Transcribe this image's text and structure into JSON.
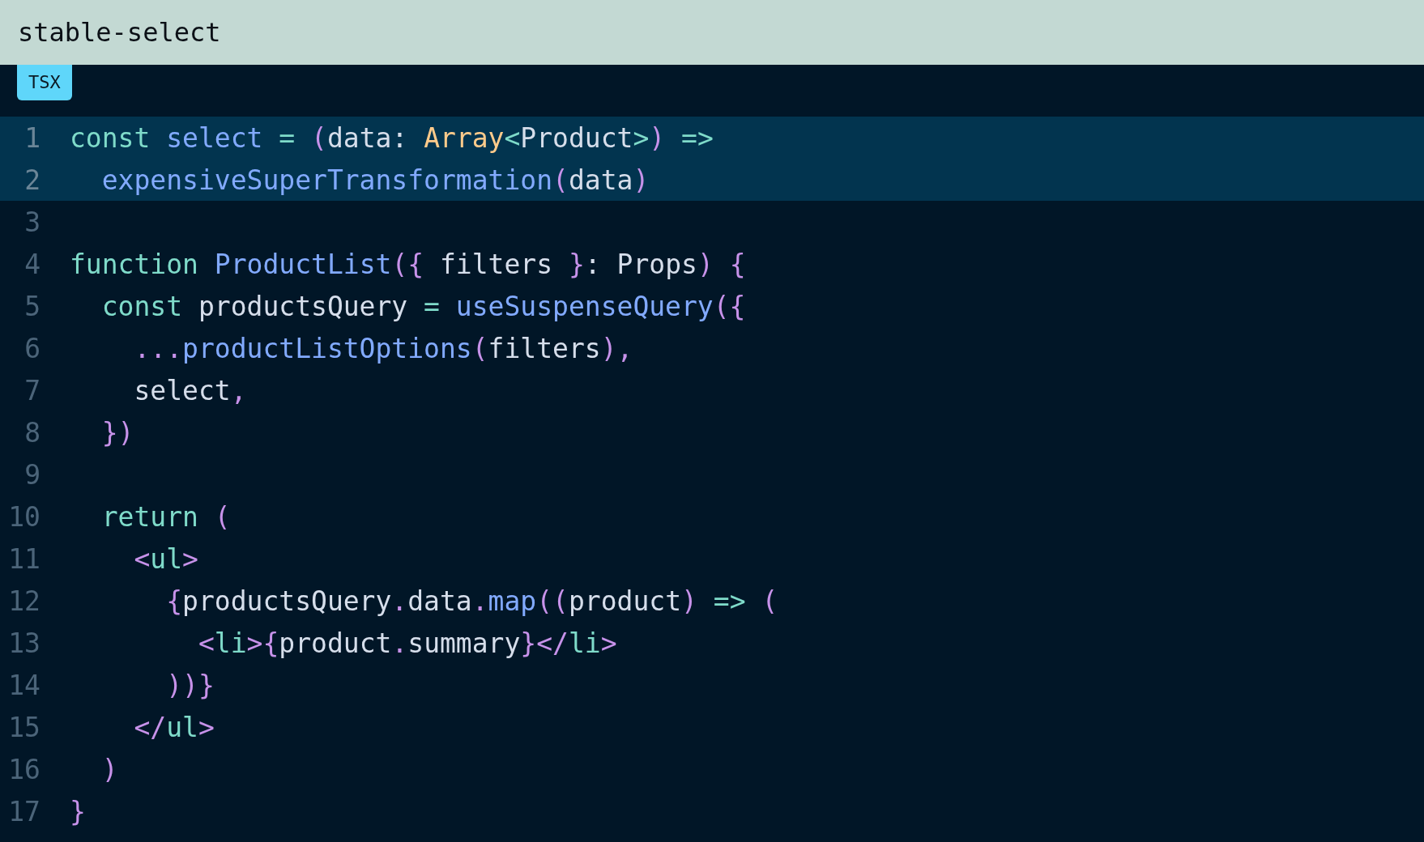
{
  "title": "stable-select",
  "language_badge": "TSX",
  "lines": [
    {
      "number": "1",
      "highlighted": true,
      "tokens": [
        {
          "text": "const",
          "kind": "keyword"
        },
        {
          "text": " select",
          "kind": "function"
        },
        {
          "text": " =",
          "kind": "keyword"
        },
        {
          "text": " (",
          "kind": "punctuation"
        },
        {
          "text": "data: ",
          "kind": "plain"
        },
        {
          "text": "Array",
          "kind": "type"
        },
        {
          "text": "<",
          "kind": "keyword"
        },
        {
          "text": "Product",
          "kind": "plain"
        },
        {
          "text": ">",
          "kind": "keyword"
        },
        {
          "text": ")",
          "kind": "punctuation"
        },
        {
          "text": " =>",
          "kind": "keyword"
        }
      ]
    },
    {
      "number": "2",
      "highlighted": true,
      "tokens": [
        {
          "text": "  expensiveSuperTransformation",
          "kind": "function"
        },
        {
          "text": "(",
          "kind": "punctuation"
        },
        {
          "text": "data",
          "kind": "plain"
        },
        {
          "text": ")",
          "kind": "punctuation"
        }
      ]
    },
    {
      "number": "3",
      "highlighted": false
    },
    {
      "number": "4",
      "highlighted": false,
      "tokens": [
        {
          "text": "function",
          "kind": "keyword"
        },
        {
          "text": " ProductList",
          "kind": "function"
        },
        {
          "text": "({",
          "kind": "punctuation"
        },
        {
          "text": " filters ",
          "kind": "plain"
        },
        {
          "text": "}",
          "kind": "punctuation"
        },
        {
          "text": ": Props",
          "kind": "plain"
        },
        {
          "text": ")",
          "kind": "punctuation"
        },
        {
          "text": " {",
          "kind": "punctuation"
        }
      ]
    },
    {
      "number": "5",
      "highlighted": false,
      "tokens": [
        {
          "text": "  const",
          "kind": "keyword"
        },
        {
          "text": " productsQuery ",
          "kind": "plain"
        },
        {
          "text": "=",
          "kind": "keyword"
        },
        {
          "text": " useSuspenseQuery",
          "kind": "function"
        },
        {
          "text": "({",
          "kind": "punctuation"
        }
      ]
    },
    {
      "number": "6",
      "highlighted": false,
      "tokens": [
        {
          "text": "    ...",
          "kind": "punctuation"
        },
        {
          "text": "productListOptions",
          "kind": "function"
        },
        {
          "text": "(",
          "kind": "punctuation"
        },
        {
          "text": "filters",
          "kind": "plain"
        },
        {
          "text": "),",
          "kind": "punctuation"
        }
      ]
    },
    {
      "number": "7",
      "highlighted": false,
      "tokens": [
        {
          "text": "    select",
          "kind": "plain"
        },
        {
          "text": ",",
          "kind": "punctuation"
        }
      ]
    },
    {
      "number": "8",
      "highlighted": false,
      "tokens": [
        {
          "text": "  })",
          "kind": "punctuation"
        }
      ]
    },
    {
      "number": "9",
      "highlighted": false
    },
    {
      "number": "10",
      "highlighted": false,
      "tokens": [
        {
          "text": "  return",
          "kind": "keyword"
        },
        {
          "text": " (",
          "kind": "punctuation"
        }
      ]
    },
    {
      "number": "11",
      "highlighted": false,
      "tokens": [
        {
          "text": "    <",
          "kind": "punctuation"
        },
        {
          "text": "ul",
          "kind": "keyword"
        },
        {
          "text": ">",
          "kind": "punctuation"
        }
      ]
    },
    {
      "number": "12",
      "highlighted": false,
      "tokens": [
        {
          "text": "      {",
          "kind": "punctuation"
        },
        {
          "text": "productsQuery",
          "kind": "plain"
        },
        {
          "text": ".",
          "kind": "punctuation"
        },
        {
          "text": "data",
          "kind": "plain"
        },
        {
          "text": ".",
          "kind": "punctuation"
        },
        {
          "text": "map",
          "kind": "function"
        },
        {
          "text": "((",
          "kind": "punctuation"
        },
        {
          "text": "product",
          "kind": "plain"
        },
        {
          "text": ")",
          "kind": "punctuation"
        },
        {
          "text": " =>",
          "kind": "keyword"
        },
        {
          "text": " (",
          "kind": "punctuation"
        }
      ]
    },
    {
      "number": "13",
      "highlighted": false,
      "tokens": [
        {
          "text": "        <",
          "kind": "punctuation"
        },
        {
          "text": "li",
          "kind": "keyword"
        },
        {
          "text": ">{",
          "kind": "punctuation"
        },
        {
          "text": "product",
          "kind": "plain"
        },
        {
          "text": ".",
          "kind": "punctuation"
        },
        {
          "text": "summary",
          "kind": "plain"
        },
        {
          "text": "}</",
          "kind": "punctuation"
        },
        {
          "text": "li",
          "kind": "keyword"
        },
        {
          "text": ">",
          "kind": "punctuation"
        }
      ]
    },
    {
      "number": "14",
      "highlighted": false,
      "tokens": [
        {
          "text": "      ))}",
          "kind": "punctuation"
        }
      ]
    },
    {
      "number": "15",
      "highlighted": false,
      "tokens": [
        {
          "text": "    </",
          "kind": "punctuation"
        },
        {
          "text": "ul",
          "kind": "keyword"
        },
        {
          "text": ">",
          "kind": "punctuation"
        }
      ]
    },
    {
      "number": "16",
      "highlighted": false,
      "tokens": [
        {
          "text": "  )",
          "kind": "punctuation"
        }
      ]
    },
    {
      "number": "17",
      "highlighted": false,
      "tokens": [
        {
          "text": "}",
          "kind": "punctuation"
        }
      ]
    }
  ]
}
